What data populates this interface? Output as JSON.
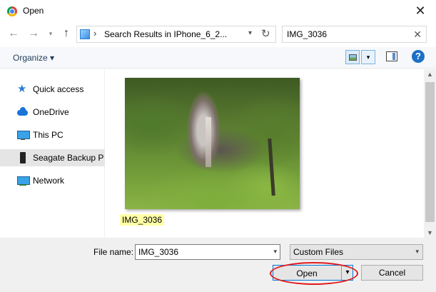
{
  "window": {
    "title": "Open",
    "icon": "chrome-icon",
    "close_glyph": "✕"
  },
  "navigation": {
    "back_glyph": "←",
    "forward_glyph": "→",
    "recent_glyph": "▾",
    "up_glyph": "↑",
    "address_separator": "›",
    "address": "Search Results in IPhone_6_2...",
    "address_dropdown_glyph": "▾",
    "refresh_glyph": "↻",
    "search_value": "IMG_3036",
    "search_clear_glyph": "✕"
  },
  "toolbar": {
    "organize_label": "Organize ▾",
    "view_dropdown_glyph": "▾",
    "help_label": "?"
  },
  "sidebar": {
    "items": [
      {
        "label": "Quick access",
        "icon": "star-icon"
      },
      {
        "label": "OneDrive",
        "icon": "cloud-icon"
      },
      {
        "label": "This PC",
        "icon": "computer-icon"
      },
      {
        "label": "Seagate Backup Plus",
        "icon": "drive-icon",
        "selected": true
      },
      {
        "label": "Network",
        "icon": "network-icon"
      }
    ]
  },
  "content": {
    "files": [
      {
        "name": "IMG_3036",
        "thumbnail": "waterfall forest photo"
      }
    ]
  },
  "scrollbar": {
    "up_glyph": "▲",
    "down_glyph": "▼"
  },
  "footer": {
    "file_name_label": "File name:",
    "file_name_value": "IMG_3036",
    "file_name_dropdown_glyph": "▾",
    "file_type_value": "Custom Files",
    "file_type_dropdown_glyph": "▾",
    "open_label": "Open",
    "open_split_glyph": "▾",
    "cancel_label": "Cancel"
  },
  "colors": {
    "highlight_ring": "#e21b1b",
    "accent": "#0078d7",
    "selection_label": "#ffffa6"
  }
}
